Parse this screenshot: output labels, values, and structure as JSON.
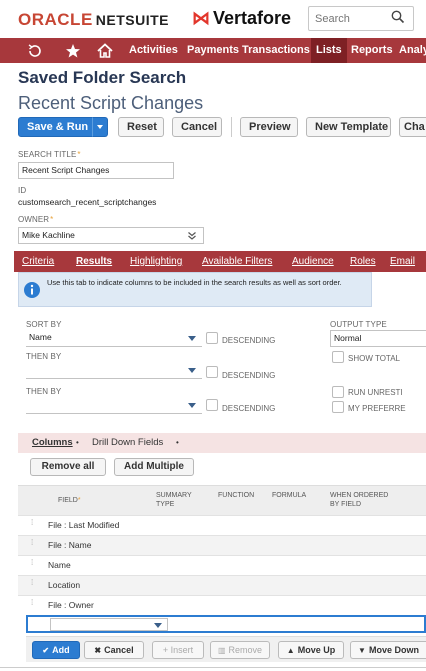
{
  "header": {
    "oracle": "ORACLE",
    "netsuite": "NETSUITE",
    "vertafore": "Vertafore",
    "search_placeholder": "Search"
  },
  "nav": {
    "items": [
      "Activities",
      "Payments",
      "Transactions",
      "Lists",
      "Reports",
      "Analy"
    ],
    "active": "Lists",
    "icons": [
      "recent-icon",
      "star-icon",
      "home-icon"
    ]
  },
  "page": {
    "type_title": "Saved Folder Search",
    "title": "Recent Script Changes"
  },
  "toolbar": {
    "save_run": "Save & Run",
    "reset": "Reset",
    "cancel": "Cancel",
    "preview": "Preview",
    "new_template": "New Template",
    "cha": "Cha"
  },
  "fields": {
    "search_title_label": "SEARCH TITLE",
    "search_title_value": "Recent Script Changes",
    "id_label": "ID",
    "id_value": "customsearch_recent_scriptchanges",
    "owner_label": "OWNER",
    "owner_value": "Mike Kachline",
    "required_mark": "*"
  },
  "subtabs": [
    "Criteria",
    "Results",
    "Highlighting",
    "Available Filters",
    "Audience",
    "Roles",
    "Email"
  ],
  "active_subtab": "Results",
  "info": {
    "text": "Use this tab to indicate columns to be included in the search results as well as sort order."
  },
  "sort": {
    "sort_by_label": "SORT BY",
    "sort_by_value": "Name",
    "then_by_label": "THEN BY",
    "then_by_label_2": "THEN BY",
    "descending_label": "DESCENDING",
    "output_type_label": "OUTPUT TYPE",
    "output_type_value": "Normal",
    "show_total": "SHOW TOTAL",
    "run_unrestricted": "RUN UNRESTI",
    "my_preferred": "MY PREFERRE"
  },
  "columns": {
    "tab_columns": "Columns",
    "tab_drilldown": "Drill Down Fields",
    "bullet": "•",
    "remove_all": "Remove all",
    "add_multiple": "Add Multiple",
    "headers": {
      "field": "FIELD",
      "summary_type_1": "SUMMARY",
      "summary_type_2": "TYPE",
      "function": "FUNCTION",
      "formula": "FORMULA",
      "when_ordered_1": "WHEN ORDERED",
      "when_ordered_2": "BY FIELD"
    },
    "rows": [
      "File : Last Modified",
      "File : Name",
      "Name",
      "Location",
      "File : Owner"
    ]
  },
  "bottom": {
    "add": "Add",
    "cancel": "Cancel",
    "insert": "+ Insert",
    "remove": "Remove",
    "move_up": "Move Up",
    "move_down": "Move Down"
  },
  "colors": {
    "nav_red": "#a7383c",
    "nav_active": "#7e2024",
    "primary_blue": "#2c7cd1",
    "title_navy": "#283754",
    "info_bg": "#dfeaf5"
  }
}
